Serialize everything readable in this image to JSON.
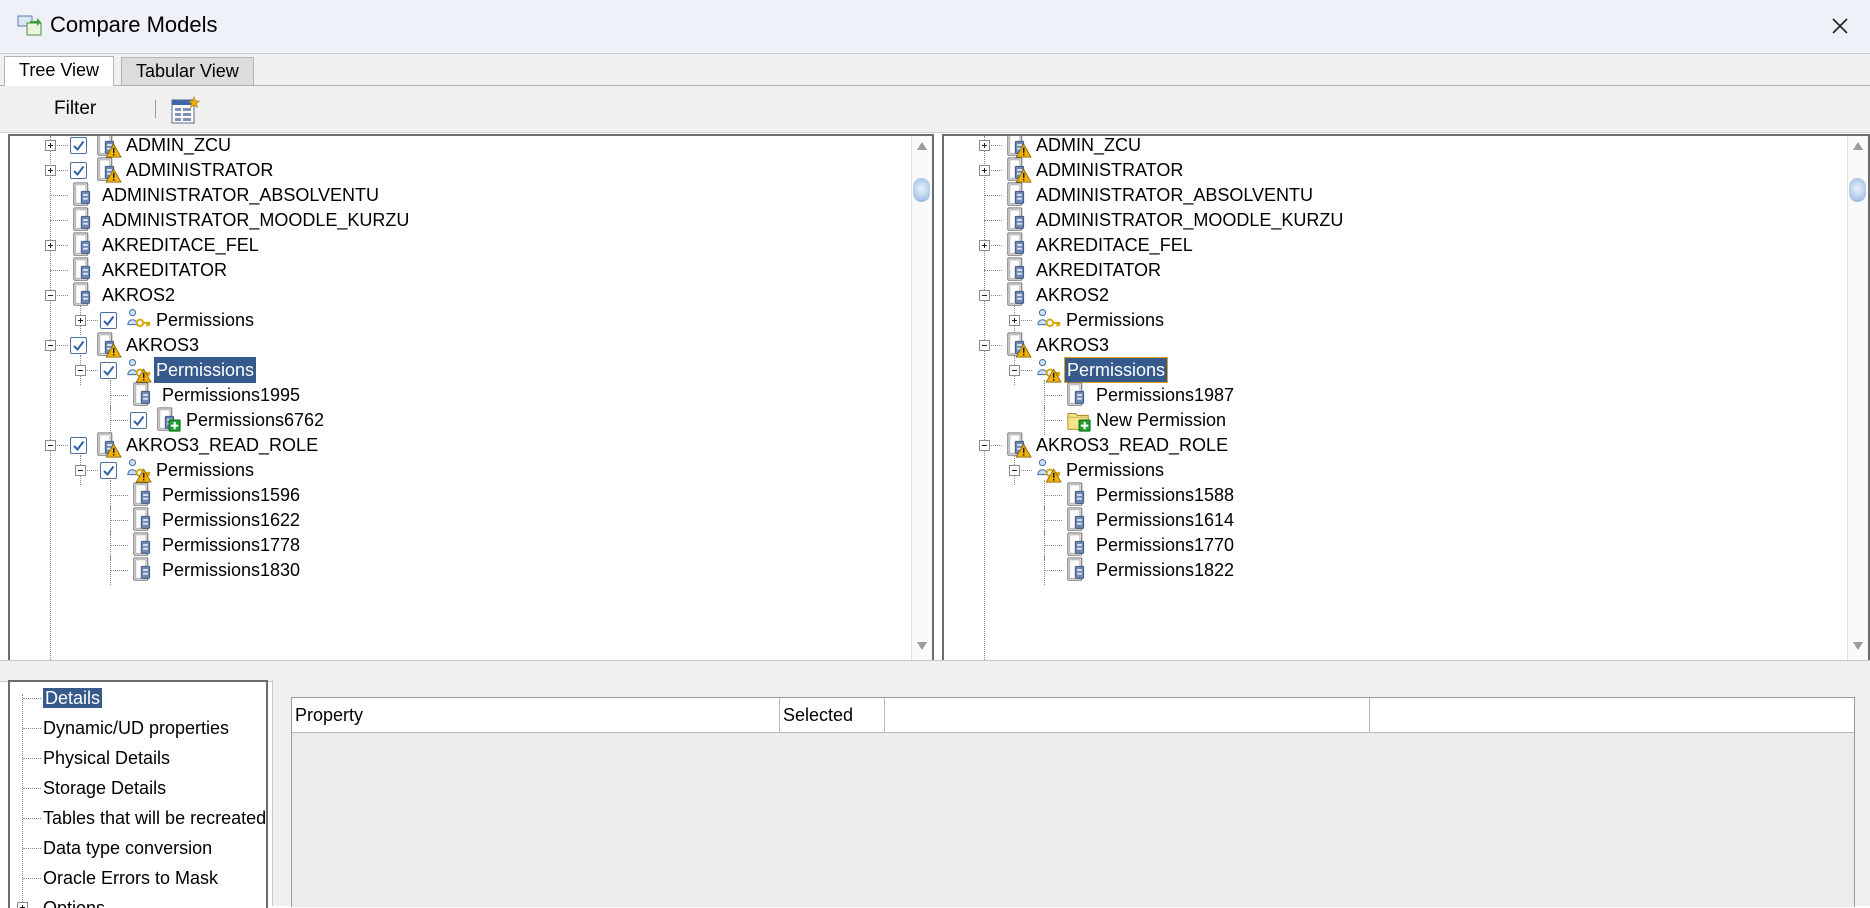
{
  "window": {
    "title": "Compare Models",
    "close_symbol": "✕"
  },
  "tabs": [
    {
      "label": "Tree View",
      "active": true
    },
    {
      "label": "Tabular View",
      "active": false
    }
  ],
  "toolbar": {
    "filter_label": "Filter",
    "report_icon": "report-icon"
  },
  "left_tree": {
    "rows": [
      {
        "label": "ADMIN_ZCU"
      },
      {
        "label": "ADMINISTRATOR"
      },
      {
        "label": "ADMINISTRATOR_ABSOLVENTU"
      },
      {
        "label": "ADMINISTRATOR_MOODLE_KURZU"
      },
      {
        "label": "AKREDITACE_FEL"
      },
      {
        "label": "AKREDITATOR"
      },
      {
        "label": "AKROS2"
      },
      {
        "label": "Permissions"
      },
      {
        "label": "AKROS3"
      },
      {
        "label": "Permissions"
      },
      {
        "label": "Permissions1995"
      },
      {
        "label": "Permissions6762"
      },
      {
        "label": "AKROS3_READ_ROLE"
      },
      {
        "label": "Permissions"
      },
      {
        "label": "Permissions1596"
      },
      {
        "label": "Permissions1622"
      },
      {
        "label": "Permissions1778"
      },
      {
        "label": "Permissions1830"
      }
    ]
  },
  "right_tree": {
    "rows": [
      {
        "label": "ADMIN_ZCU"
      },
      {
        "label": "ADMINISTRATOR"
      },
      {
        "label": "ADMINISTRATOR_ABSOLVENTU"
      },
      {
        "label": "ADMINISTRATOR_MOODLE_KURZU"
      },
      {
        "label": "AKREDITACE_FEL"
      },
      {
        "label": "AKREDITATOR"
      },
      {
        "label": "AKROS2"
      },
      {
        "label": "Permissions"
      },
      {
        "label": "AKROS3"
      },
      {
        "label": "Permissions"
      },
      {
        "label": "Permissions1987"
      },
      {
        "label": "New Permission"
      },
      {
        "label": "AKROS3_READ_ROLE"
      },
      {
        "label": "Permissions"
      },
      {
        "label": "Permissions1588"
      },
      {
        "label": "Permissions1614"
      },
      {
        "label": "Permissions1770"
      },
      {
        "label": "Permissions1822"
      }
    ]
  },
  "nav": {
    "items": [
      {
        "label": "Details",
        "selected": true
      },
      {
        "label": "Dynamic/UD properties"
      },
      {
        "label": "Physical Details"
      },
      {
        "label": "Storage Details"
      },
      {
        "label": "Tables that will be recreated"
      },
      {
        "label": "Data type conversion"
      },
      {
        "label": "Oracle Errors to Mask"
      },
      {
        "label": "Options"
      }
    ]
  },
  "properties": {
    "columns": [
      "Property",
      "Selected",
      "",
      ""
    ]
  },
  "colors": {
    "selection": "#365a8c",
    "warning": "#f2b100",
    "added": "#1fa030",
    "checkbox": "#2f62a8"
  }
}
